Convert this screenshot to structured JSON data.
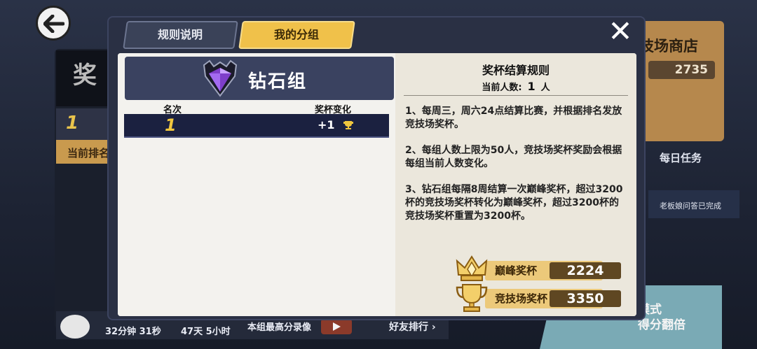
{
  "background": {
    "left_title": "奖",
    "left_rank": "1",
    "current_rank_label": "当前排名",
    "shop_title": "技场商店",
    "shop_coins": "2735",
    "daily_tasks": "每日任务",
    "boss_quiz_done": "老板娘问答已完成",
    "mode_text_line1": "模式",
    "mode_text_line2": "得分翻倍",
    "bottom": {
      "timer1": "32分钟 31秒",
      "timer2": "47天 5小时",
      "best_replay": "本组最高分录像",
      "friends_rank": "好友排行 ›"
    }
  },
  "tabs": [
    {
      "label": "规则说明",
      "active": false
    },
    {
      "label": "我的分组",
      "active": true
    }
  ],
  "group": {
    "name": "钻石组",
    "icon": "diamond-icon",
    "columns": {
      "rank": "名次",
      "trophy_change": "奖杯变化"
    },
    "rows": [
      {
        "rank": "1",
        "change": "+1"
      }
    ]
  },
  "rules": {
    "title": "奖杯结算规则",
    "count_label": "当前人数:",
    "count_value": "1",
    "count_unit": "人",
    "items": [
      "1、每周三，周六24点结算比赛，并根据排名发放竞技场奖杯。",
      "2、每组人数上限为50人，竞技场奖杯奖励会根据每组当前人数变化。",
      "3、钻石组每隔8周结算一次巅峰奖杯，超过3200杯的竞技场奖杯转化为巅峰奖杯，超过3200杯的竞技场奖杯重置为3200杯。"
    ]
  },
  "cups": {
    "peak": {
      "label": "巅峰奖杯",
      "value": "2224",
      "icon": "crown-trophy-icon"
    },
    "arena": {
      "label": "竞技场奖杯",
      "value": "3350",
      "icon": "trophy-icon"
    }
  },
  "colors": {
    "active_tab": "#f0c14a",
    "row_bg": "#1b2140",
    "gold": "#f0c63e",
    "cup_label": "#ecc97a"
  }
}
